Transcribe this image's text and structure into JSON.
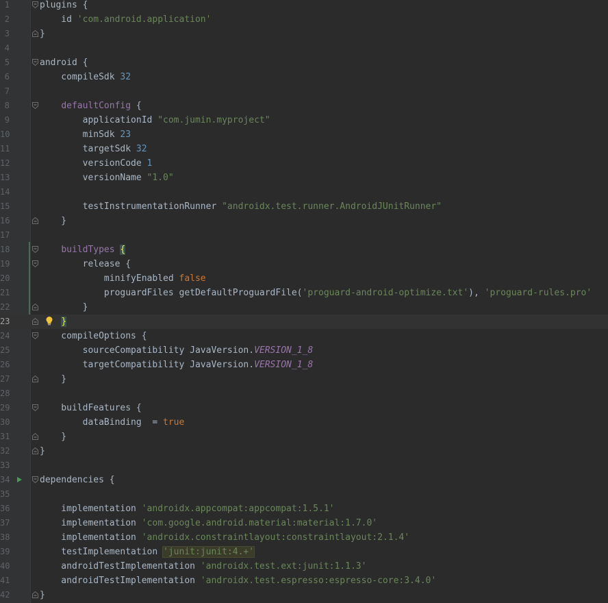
{
  "editor": {
    "lines": [
      {
        "n": "1",
        "tokens": [
          {
            "t": "plugins {",
            "c": ""
          }
        ],
        "fold": "top"
      },
      {
        "n": "2",
        "tokens": [
          {
            "t": "    id ",
            "c": ""
          },
          {
            "t": "'com.android.application'",
            "c": "str"
          }
        ]
      },
      {
        "n": "3",
        "tokens": [
          {
            "t": "}",
            "c": ""
          }
        ],
        "fold": "bottom"
      },
      {
        "n": "4",
        "tokens": []
      },
      {
        "n": "5",
        "tokens": [
          {
            "t": "android {",
            "c": ""
          }
        ],
        "fold": "top"
      },
      {
        "n": "6",
        "tokens": [
          {
            "t": "    compileSdk ",
            "c": ""
          },
          {
            "t": "32",
            "c": "num"
          }
        ]
      },
      {
        "n": "7",
        "tokens": []
      },
      {
        "n": "8",
        "tokens": [
          {
            "t": "    ",
            "c": ""
          },
          {
            "t": "defaultConfig",
            "c": "purple"
          },
          {
            "t": " {",
            "c": ""
          }
        ],
        "fold": "top"
      },
      {
        "n": "9",
        "tokens": [
          {
            "t": "        applicationId ",
            "c": ""
          },
          {
            "t": "\"com.jumin.myproject\"",
            "c": "str"
          }
        ]
      },
      {
        "n": "10",
        "tokens": [
          {
            "t": "        minSdk ",
            "c": ""
          },
          {
            "t": "23",
            "c": "num"
          }
        ]
      },
      {
        "n": "11",
        "tokens": [
          {
            "t": "        targetSdk ",
            "c": ""
          },
          {
            "t": "32",
            "c": "num"
          }
        ]
      },
      {
        "n": "12",
        "tokens": [
          {
            "t": "        versionCode ",
            "c": ""
          },
          {
            "t": "1",
            "c": "num"
          }
        ]
      },
      {
        "n": "13",
        "tokens": [
          {
            "t": "        versionName ",
            "c": ""
          },
          {
            "t": "\"1.0\"",
            "c": "str"
          }
        ]
      },
      {
        "n": "14",
        "tokens": []
      },
      {
        "n": "15",
        "tokens": [
          {
            "t": "        testInstrumentationRunner ",
            "c": ""
          },
          {
            "t": "\"androidx.test.runner.AndroidJUnitRunner\"",
            "c": "str"
          }
        ]
      },
      {
        "n": "16",
        "tokens": [
          {
            "t": "    }",
            "c": ""
          }
        ],
        "fold": "bottom"
      },
      {
        "n": "17",
        "tokens": []
      },
      {
        "n": "18",
        "tokens": [
          {
            "t": "    ",
            "c": ""
          },
          {
            "t": "buildTypes",
            "c": "purple"
          },
          {
            "t": " ",
            "c": ""
          },
          {
            "t": "{",
            "c": "bracehl"
          }
        ],
        "fold": "top"
      },
      {
        "n": "19",
        "tokens": [
          {
            "t": "        release {",
            "c": ""
          }
        ],
        "fold": "top"
      },
      {
        "n": "20",
        "tokens": [
          {
            "t": "            minifyEnabled ",
            "c": ""
          },
          {
            "t": "false",
            "c": "kw"
          }
        ]
      },
      {
        "n": "21",
        "tokens": [
          {
            "t": "            proguardFiles getDefaultProguardFile(",
            "c": ""
          },
          {
            "t": "'proguard-android-optimize.txt'",
            "c": "str"
          },
          {
            "t": "), ",
            "c": ""
          },
          {
            "t": "'proguard-rules.pro'",
            "c": "str"
          }
        ]
      },
      {
        "n": "22",
        "tokens": [
          {
            "t": "        }",
            "c": ""
          }
        ],
        "fold": "bottom"
      },
      {
        "n": "23",
        "tokens": [
          {
            "t": "    ",
            "c": ""
          },
          {
            "t": "}",
            "c": "bracehl"
          }
        ],
        "fold": "bottom",
        "current": true,
        "bulb": true
      },
      {
        "n": "24",
        "tokens": [
          {
            "t": "    compileOptions {",
            "c": ""
          }
        ],
        "fold": "top"
      },
      {
        "n": "25",
        "tokens": [
          {
            "t": "        sourceCompatibility JavaVersion.",
            "c": ""
          },
          {
            "t": "VERSION_1_8",
            "c": "const"
          }
        ]
      },
      {
        "n": "26",
        "tokens": [
          {
            "t": "        targetCompatibility JavaVersion.",
            "c": ""
          },
          {
            "t": "VERSION_1_8",
            "c": "const"
          }
        ]
      },
      {
        "n": "27",
        "tokens": [
          {
            "t": "    }",
            "c": ""
          }
        ],
        "fold": "bottom"
      },
      {
        "n": "28",
        "tokens": []
      },
      {
        "n": "29",
        "tokens": [
          {
            "t": "    buildFeatures {",
            "c": ""
          }
        ],
        "fold": "top"
      },
      {
        "n": "30",
        "tokens": [
          {
            "t": "        dataBinding  = ",
            "c": ""
          },
          {
            "t": "true",
            "c": "kw"
          }
        ]
      },
      {
        "n": "31",
        "tokens": [
          {
            "t": "    }",
            "c": ""
          }
        ],
        "fold": "bottom"
      },
      {
        "n": "32",
        "tokens": [
          {
            "t": "}",
            "c": ""
          }
        ],
        "fold": "bottom"
      },
      {
        "n": "33",
        "tokens": []
      },
      {
        "n": "34",
        "tokens": [
          {
            "t": "dependencies {",
            "c": ""
          }
        ],
        "fold": "top",
        "run": true
      },
      {
        "n": "35",
        "tokens": []
      },
      {
        "n": "36",
        "tokens": [
          {
            "t": "    implementation ",
            "c": ""
          },
          {
            "t": "'androidx.appcompat:appcompat:1.5.1'",
            "c": "str"
          }
        ]
      },
      {
        "n": "37",
        "tokens": [
          {
            "t": "    implementation ",
            "c": ""
          },
          {
            "t": "'com.google.android.material:material:1.7.0'",
            "c": "str"
          }
        ]
      },
      {
        "n": "38",
        "tokens": [
          {
            "t": "    implementation ",
            "c": ""
          },
          {
            "t": "'androidx.constraintlayout:constraintlayout:2.1.4'",
            "c": "str"
          }
        ]
      },
      {
        "n": "39",
        "tokens": [
          {
            "t": "    testImplementation ",
            "c": ""
          },
          {
            "t": "'junit:junit:4.+'",
            "c": "strhl"
          }
        ]
      },
      {
        "n": "40",
        "tokens": [
          {
            "t": "    androidTestImplementation ",
            "c": ""
          },
          {
            "t": "'androidx.test.ext:junit:1.1.3'",
            "c": "str"
          }
        ]
      },
      {
        "n": "41",
        "tokens": [
          {
            "t": "    androidTestImplementation ",
            "c": ""
          },
          {
            "t": "'androidx.test.espresso:espresso-core:3.4.0'",
            "c": "str"
          }
        ]
      },
      {
        "n": "42",
        "tokens": [
          {
            "t": "}",
            "c": ""
          }
        ],
        "fold": "bottom"
      }
    ]
  },
  "icons": {
    "fold": "fold-marker-icon",
    "run": "run-gutter-icon",
    "bulb": "intention-bulb-icon"
  },
  "colors": {
    "background": "#2b2b2b",
    "gutter": "#313335",
    "text": "#a9b7c6",
    "keyword": "#cc7832",
    "string": "#6a8759",
    "number": "#6897bb",
    "purple": "#9876aa",
    "run": "#499c54",
    "bulb": "#f0c33c"
  }
}
